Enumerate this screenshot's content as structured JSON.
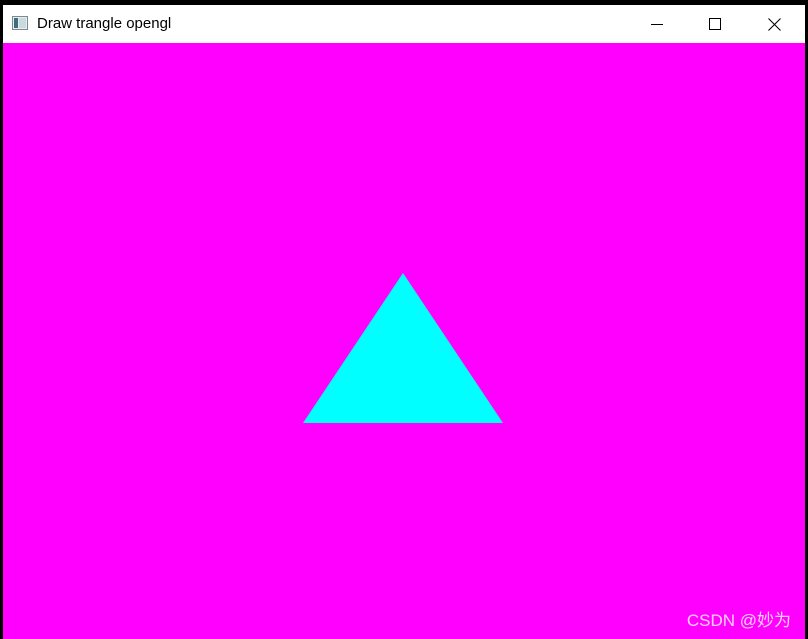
{
  "window": {
    "title": "Draw trangle opengl",
    "icon": "application-window-icon",
    "controls": {
      "minimize": "minimize-icon",
      "maximize": "maximize-icon",
      "close": "close-icon"
    }
  },
  "canvas": {
    "background_color": "#ff00ff",
    "shape": "triangle",
    "triangle_color": "#00ffff"
  },
  "watermark": {
    "text": "CSDN @妙为"
  }
}
